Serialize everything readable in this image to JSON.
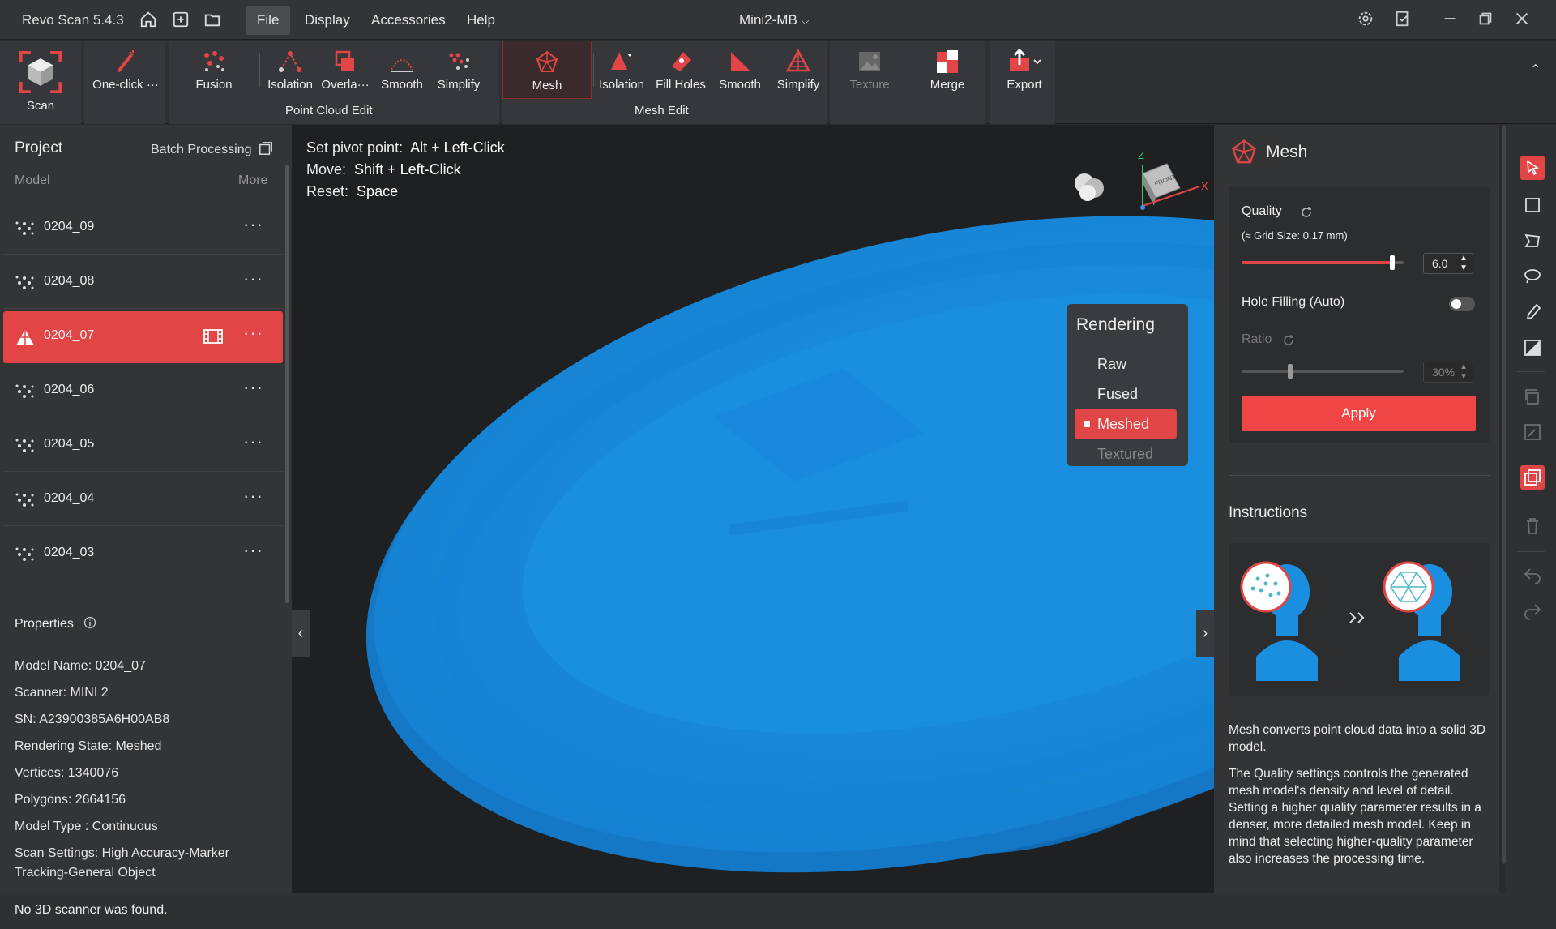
{
  "titlebar": {
    "app_title": "Revo Scan 5.4.3",
    "menus": [
      "File",
      "Display",
      "Accessories",
      "Help"
    ],
    "active_menu": "File",
    "device": "Mini2-MB"
  },
  "ribbon": {
    "scan": "Scan",
    "one_click": "One-click ···",
    "fusion": "Fusion",
    "pc_isolation": "Isolation",
    "pc_overlap": "Overla···",
    "pc_smooth": "Smooth",
    "pc_simplify": "Simplify",
    "point_cloud_edit": "Point Cloud Edit",
    "mesh": "Mesh",
    "m_isolation": "Isolation",
    "m_fill_holes": "Fill Holes",
    "m_smooth": "Smooth",
    "m_simplify": "Simplify",
    "mesh_edit": "Mesh Edit",
    "texture": "Texture",
    "merge": "Merge",
    "export": "Export"
  },
  "project": {
    "title": "Project",
    "batch_processing": "Batch Processing",
    "model_col": "Model",
    "more_col": "More",
    "models": [
      {
        "name": "0204_09",
        "type": "point-cloud"
      },
      {
        "name": "0204_08",
        "type": "point-cloud"
      },
      {
        "name": "0204_07",
        "type": "mesh",
        "selected": true
      },
      {
        "name": "0204_06",
        "type": "point-cloud"
      },
      {
        "name": "0204_05",
        "type": "point-cloud"
      },
      {
        "name": "0204_04",
        "type": "point-cloud"
      },
      {
        "name": "0204_03",
        "type": "point-cloud"
      }
    ],
    "more_symbol": "···"
  },
  "properties": {
    "title": "Properties",
    "model_name": "Model Name:  0204_07",
    "scanner": "Scanner:  MINI 2",
    "sn": "SN:  A23900385A6H00AB8",
    "rendering_state": "Rendering State:  Meshed",
    "vertices": "Vertices:  1340076",
    "polygons": "Polygons:  2664156",
    "model_type": "Model Type :  Continuous",
    "scan_settings": "Scan Settings:  High Accuracy-Marker Tracking-General Object"
  },
  "viewport": {
    "hints": [
      {
        "label": "Set pivot point:",
        "key": "Alt + Left-Click"
      },
      {
        "label": "Move:",
        "key": "Shift + Left-Click"
      },
      {
        "label": "Reset:",
        "key": "Space"
      }
    ],
    "axis_z": "Z",
    "axis_x": "X",
    "cube_face": "FRONT",
    "model_color": "#1a8fe0"
  },
  "rendering": {
    "title": "Rendering",
    "options": [
      "Raw",
      "Fused",
      "Meshed",
      "Textured"
    ],
    "selected": "Meshed"
  },
  "mesh_panel": {
    "title": "Mesh",
    "quality_label": "Quality",
    "grid_size": "(≈ Grid Size: 0.17 mm)",
    "quality_value": "6.0",
    "quality_fraction": 0.93,
    "hole_filling_label": "Hole Filling (Auto)",
    "hole_filling_on": false,
    "ratio_label": "Ratio",
    "ratio_value": "30%",
    "ratio_fraction": 0.3,
    "apply": "Apply",
    "instructions_title": "Instructions",
    "desc1": "Mesh converts point cloud data into a solid 3D model.",
    "desc2": "The Quality settings controls the generated mesh model's density and level of detail. Setting a higher quality parameter results in a denser, more detailed mesh model. Keep in mind that selecting higher-quality parameter also increases the processing time."
  },
  "status": {
    "message": "No 3D scanner was found."
  },
  "colors": {
    "accent": "#e24545",
    "panel": "#333436",
    "background": "#1f2021"
  }
}
